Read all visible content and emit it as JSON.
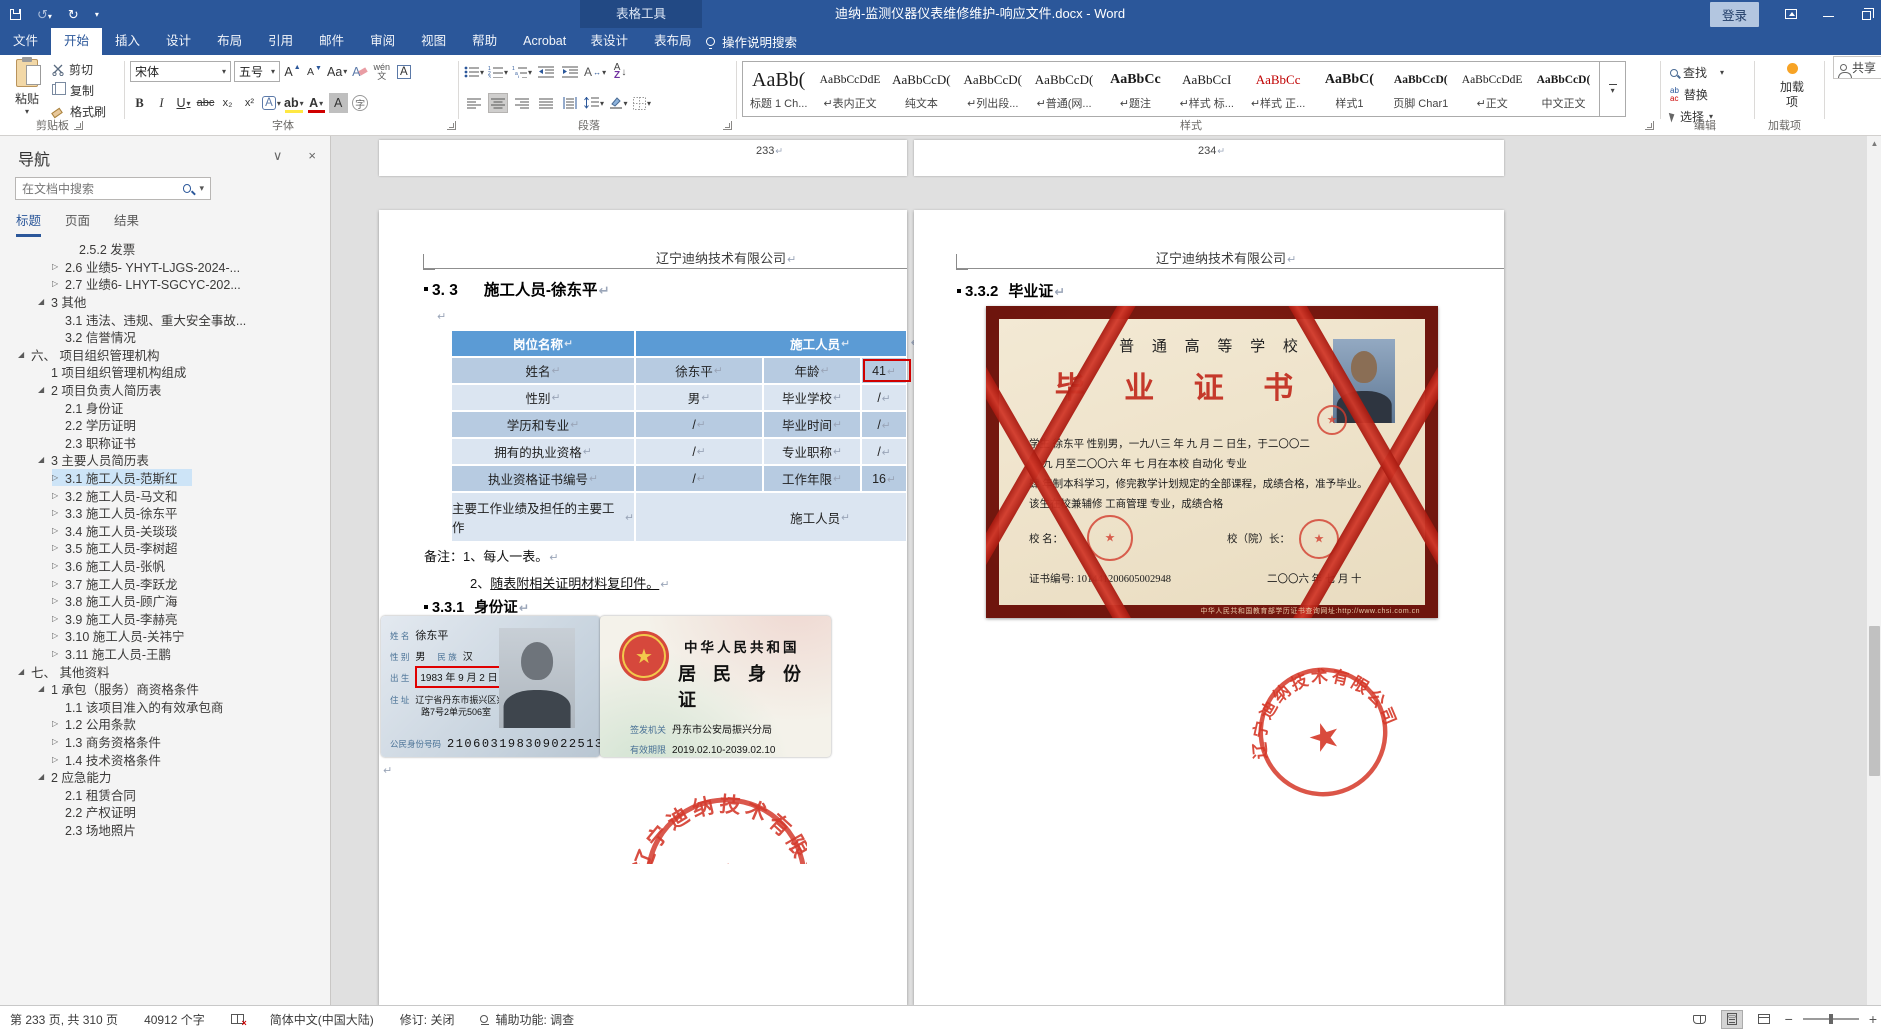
{
  "titlebar": {
    "contextual_tool": "表格工具",
    "title": "迪纳-监测仪器仪表维修维护-响应文件.docx  -  Word",
    "signin": "登录"
  },
  "tabs": {
    "items": [
      {
        "label": "文件",
        "active": false
      },
      {
        "label": "开始",
        "active": true
      },
      {
        "label": "插入",
        "active": false
      },
      {
        "label": "设计",
        "active": false
      },
      {
        "label": "布局",
        "active": false
      },
      {
        "label": "引用",
        "active": false
      },
      {
        "label": "邮件",
        "active": false
      },
      {
        "label": "审阅",
        "active": false
      },
      {
        "label": "视图",
        "active": false
      },
      {
        "label": "帮助",
        "active": false
      },
      {
        "label": "Acrobat",
        "active": false
      }
    ],
    "contextual": [
      {
        "label": "表设计"
      },
      {
        "label": "表布局"
      }
    ],
    "search": "操作说明搜索",
    "share": "共享"
  },
  "ribbon": {
    "clipboard": {
      "label": "剪贴板",
      "paste": "粘贴",
      "cut": "剪切",
      "copy": "复制",
      "format_painter": "格式刷"
    },
    "font": {
      "label": "字体",
      "font_name": "宋体",
      "font_size": "五号",
      "wen": "wén",
      "wen2": "文"
    },
    "paragraph": {
      "label": "段落"
    },
    "styles": {
      "label": "样式",
      "items": [
        {
          "sample": "AaBb(",
          "name": "标题 1 Ch...",
          "kind": "title",
          "selected": false
        },
        {
          "sample": "AaBbCcDdE",
          "name": "↵表内正文",
          "kind": "plain-sm",
          "selected": false
        },
        {
          "sample": "AaBbCcD(",
          "name": "纯文本",
          "kind": "plain",
          "selected": false
        },
        {
          "sample": "AaBbCcD(",
          "name": "↵列出段...",
          "kind": "plain",
          "selected": false
        },
        {
          "sample": "AaBbCcD(",
          "name": "↵普通(网...",
          "kind": "plain",
          "selected": false
        },
        {
          "sample": "AaBbCc",
          "name": "↵题注",
          "kind": "bold",
          "selected": false
        },
        {
          "sample": "AaBbCcI",
          "name": "↵样式 标...",
          "kind": "plain",
          "selected": false
        },
        {
          "sample": "AaBbCc",
          "name": "↵样式 正...",
          "kind": "red",
          "selected": false
        },
        {
          "sample": "AaBbC(",
          "name": "样式1",
          "kind": "bold",
          "selected": false
        },
        {
          "sample": "AaBbCcD(",
          "name": "页脚 Char1",
          "kind": "bold-sm",
          "selected": false
        },
        {
          "sample": "AaBbCcDdE",
          "name": "↵正文",
          "kind": "plain-sm",
          "selected": true
        },
        {
          "sample": "AaBbCcD(",
          "name": "中文正文",
          "kind": "bold-sm",
          "selected": false
        }
      ]
    },
    "editing": {
      "label": "编辑",
      "find": "查找",
      "replace": "替换",
      "select": "选择"
    },
    "addins": {
      "label": "加载项",
      "button": "加载项"
    }
  },
  "nav": {
    "title": "导航",
    "search_placeholder": "在文档中搜索",
    "tabs": [
      {
        "label": "标题",
        "active": true
      },
      {
        "label": "页面",
        "active": false
      },
      {
        "label": "结果",
        "active": false
      }
    ],
    "items": [
      {
        "arrow": "",
        "level": 4,
        "text": "2.5.2 发票",
        "selected": false
      },
      {
        "arrow": "▷",
        "level": 3,
        "text": "2.6 业绩5- YHYT-LJGS-2024-...",
        "selected": false
      },
      {
        "arrow": "▷",
        "level": 3,
        "text": "2.7 业绩6- LHYT-SGCYC-202...",
        "selected": false
      },
      {
        "arrow": "◢",
        "level": 2,
        "text": "3 其他",
        "selected": false
      },
      {
        "arrow": "",
        "level": 3,
        "text": "3.1 违法、违规、重大安全事故...",
        "selected": false
      },
      {
        "arrow": "",
        "level": 3,
        "text": "3.2 信誉情况",
        "selected": false
      },
      {
        "arrow": "◢",
        "level": 1,
        "text": "六、 项目组织管理机构",
        "selected": false
      },
      {
        "arrow": "",
        "level": 2,
        "text": "1 项目组织管理机构组成",
        "selected": false
      },
      {
        "arrow": "◢",
        "level": 2,
        "text": "2 项目负责人简历表",
        "selected": false
      },
      {
        "arrow": "",
        "level": 3,
        "text": "2.1 身份证",
        "selected": false
      },
      {
        "arrow": "",
        "level": 3,
        "text": "2.2 学历证明",
        "selected": false
      },
      {
        "arrow": "",
        "level": 3,
        "text": "2.3 职称证书",
        "selected": false
      },
      {
        "arrow": "◢",
        "level": 2,
        "text": "3 主要人员简历表",
        "selected": false
      },
      {
        "arrow": "▷",
        "level": 3,
        "text": "3.1 施工人员-范斯红",
        "selected": true
      },
      {
        "arrow": "▷",
        "level": 3,
        "text": "3.2 施工人员-马文和",
        "selected": false
      },
      {
        "arrow": "▷",
        "level": 3,
        "text": "3.3 施工人员-徐东平",
        "selected": false
      },
      {
        "arrow": "▷",
        "level": 3,
        "text": "3.4 施工人员-关琰琰",
        "selected": false
      },
      {
        "arrow": "▷",
        "level": 3,
        "text": "3.5 施工人员-李树超",
        "selected": false
      },
      {
        "arrow": "▷",
        "level": 3,
        "text": "3.6 施工人员-张帆",
        "selected": false
      },
      {
        "arrow": "▷",
        "level": 3,
        "text": "3.7 施工人员-李跃龙",
        "selected": false
      },
      {
        "arrow": "▷",
        "level": 3,
        "text": "3.8 施工人员-顾广海",
        "selected": false
      },
      {
        "arrow": "▷",
        "level": 3,
        "text": "3.9 施工人员-李赫亮",
        "selected": false
      },
      {
        "arrow": "▷",
        "level": 3,
        "text": "3.10 施工人员-关祎宁",
        "selected": false
      },
      {
        "arrow": "▷",
        "level": 3,
        "text": "3.11 施工人员-王鹏",
        "selected": false
      },
      {
        "arrow": "◢",
        "level": 1,
        "text": "七、 其他资料",
        "selected": false
      },
      {
        "arrow": "◢",
        "level": 2,
        "text": "1 承包（服务）商资格条件",
        "selected": false
      },
      {
        "arrow": "",
        "level": 3,
        "text": "1.1 该项目准入的有效承包商",
        "selected": false
      },
      {
        "arrow": "▷",
        "level": 3,
        "text": "1.2 公用条款",
        "selected": false
      },
      {
        "arrow": "▷",
        "level": 3,
        "text": "1.3 商务资格条件",
        "selected": false
      },
      {
        "arrow": "▷",
        "level": 3,
        "text": "1.4 技术资格条件",
        "selected": false
      },
      {
        "arrow": "◢",
        "level": 2,
        "text": "2 应急能力",
        "selected": false
      },
      {
        "arrow": "",
        "level": 3,
        "text": "2.1 租赁合同",
        "selected": false
      },
      {
        "arrow": "",
        "level": 3,
        "text": "2.2 产权证明",
        "selected": false
      },
      {
        "arrow": "",
        "level": 3,
        "text": "2.3 场地照片",
        "selected": false
      }
    ]
  },
  "document": {
    "prev_footer_left": "233",
    "prev_footer_right": "234",
    "page_left": {
      "header": "辽宁迪纳技术有限公司",
      "heading_num": "3. 3",
      "heading_title": "施工人员-徐东平",
      "table": {
        "header_col1": "岗位名称",
        "header_col2": "施工人员",
        "rows": [
          {
            "c1": "姓名",
            "c2": "徐东平",
            "c3": "年龄",
            "c4": "41",
            "boxed": true
          },
          {
            "c1": "性别",
            "c2": "男",
            "c3": "毕业学校",
            "c4": "/"
          },
          {
            "c1": "学历和专业",
            "c2": "/",
            "c3": "毕业时间",
            "c4": "/"
          },
          {
            "c1": "拥有的执业资格",
            "c2": "/",
            "c3": "专业职称",
            "c4": "/"
          },
          {
            "c1": "执业资格证书编号",
            "c2": "/",
            "c3": "工作年限",
            "c4": "16"
          }
        ],
        "merged_label": "主要工作业绩及担任的主要工作",
        "merged_value": "施工人员"
      },
      "note1": "备注：1、每人一表。",
      "note2_prefix": "2、",
      "note2_underlined": "随表附相关证明材料复印件。",
      "sub_heading_num": "3.3.1",
      "sub_heading_title": "身份证",
      "id_front": {
        "name_label": "姓 名",
        "name": "徐东平",
        "sex_label": "性 别",
        "sex": "男",
        "ethnic_label": "民 族",
        "ethnic": "汉",
        "birth_label": "出 生",
        "birth": "1983 年 9 月 2 日",
        "addr_label": "住 址",
        "addr1": "辽宁省丹东市振兴区兴七",
        "addr2": "路7号2单元506室",
        "id_label": "公民身份号码",
        "id_number": "210603198309022513"
      },
      "id_back": {
        "country": "中华人民共和国",
        "card_name": "居 民 身 份 证",
        "issue_label": "签发机关",
        "issue": "丹东市公安局振兴分局",
        "valid_label": "有效期限",
        "valid": "2019.02.10-2039.02.10"
      }
    },
    "page_right": {
      "header": "辽宁迪纳技术有限公司",
      "heading_num": "3.3.2",
      "heading_title": "毕业证",
      "diploma": {
        "school_type": "普 通 高 等 学 校",
        "title": "毕 业 证 书",
        "line1": "学生 徐东平  性别男，一九八三 年 九 月 二 日生，于二〇〇二",
        "line2": "年 九 月至二〇〇六 年 七 月在本校  自动化  专业",
        "line3": "肆 年制本科学习，修完教学计划规定的全部课程，成绩合格，准予毕业。",
        "line4": "该生在校兼辅修  工商管理  专业，成绩合格",
        "line5a": "校  名：",
        "line5b": "校（院）长：",
        "cert_no": "证书编号: 101441200605002948",
        "cert_date": "二〇〇六 年 七 月 十",
        "url": "中华人民共和国教育部学历证书查询网址:http://www.chsi.com.cn"
      },
      "stamp_text": "辽宁迪纳技术有限公司"
    }
  },
  "statusbar": {
    "page_info": "第 233 页, 共 310 页",
    "word_count": "40912 个字",
    "language": "简体中文(中国大陆)",
    "track_changes": "修订: 关闭",
    "accessibility": "辅助功能: 调查"
  }
}
